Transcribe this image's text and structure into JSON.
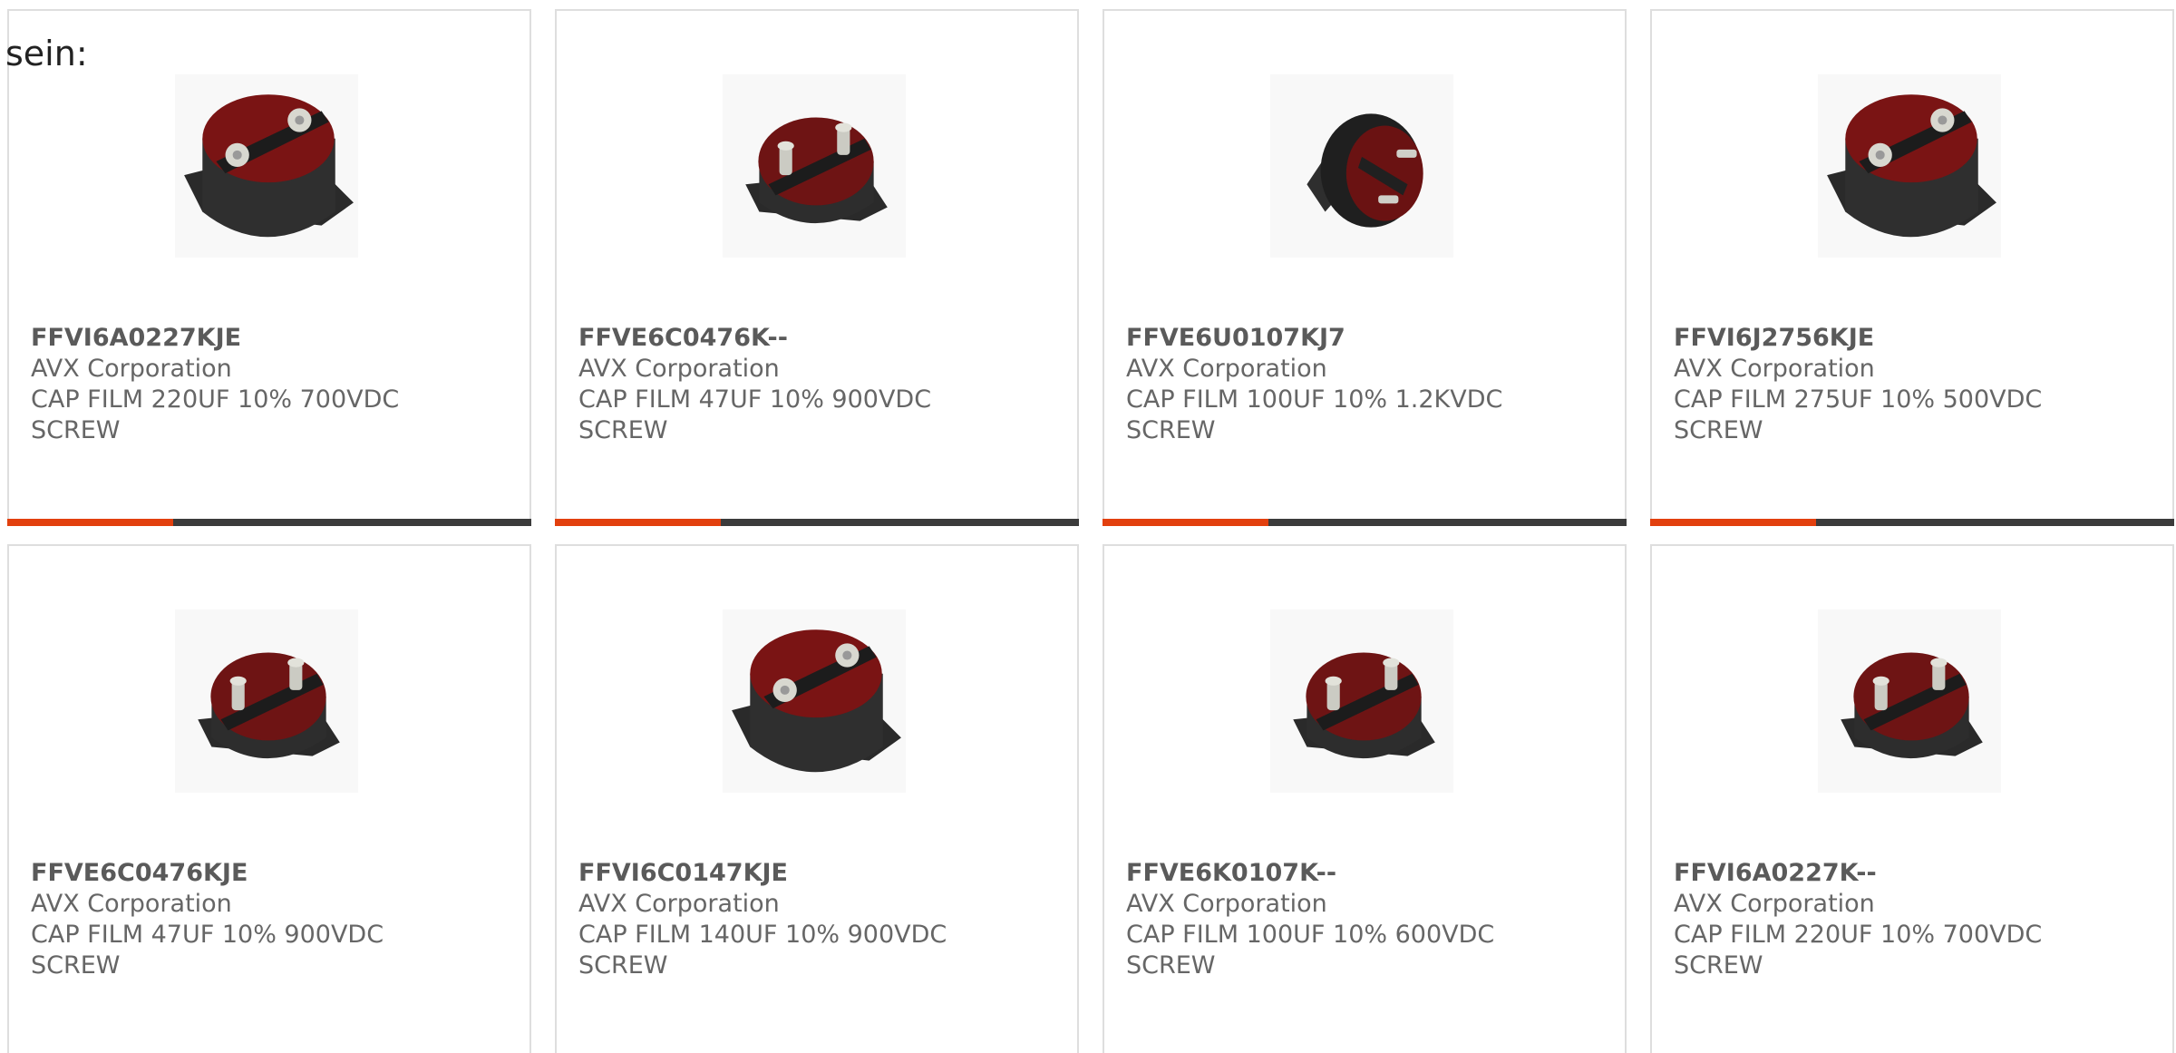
{
  "intro_text": "sein:",
  "colors": {
    "accent": "#e2400e",
    "bar": "#3b3b3b",
    "text": "#666666",
    "border": "#dedede"
  },
  "products": [
    {
      "part_number": "FFVI6A0227KJE",
      "manufacturer": "AVX Corporation",
      "description": "CAP FILM 220UF 10% 700VDC",
      "mount": "SCREW",
      "image": "capacitor-large-top-icon"
    },
    {
      "part_number": "FFVE6C0476K--",
      "manufacturer": "AVX Corporation",
      "description": "CAP FILM 47UF 10% 900VDC",
      "mount": "SCREW",
      "image": "capacitor-small-icon"
    },
    {
      "part_number": "FFVE6U0107KJ7",
      "manufacturer": "AVX Corporation",
      "description": "CAP FILM 100UF 10% 1.2KVDC",
      "mount": "SCREW",
      "image": "capacitor-side-icon"
    },
    {
      "part_number": "FFVI6J2756KJE",
      "manufacturer": "AVX Corporation",
      "description": "CAP FILM 275UF 10% 500VDC",
      "mount": "SCREW",
      "image": "capacitor-large-top-icon"
    },
    {
      "part_number": "FFVE6C0476KJE",
      "manufacturer": "AVX Corporation",
      "description": "CAP FILM 47UF 10% 900VDC",
      "mount": "SCREW",
      "image": "capacitor-small-icon"
    },
    {
      "part_number": "FFVI6C0147KJE",
      "manufacturer": "AVX Corporation",
      "description": "CAP FILM 140UF 10% 900VDC",
      "mount": "SCREW",
      "image": "capacitor-large-top-icon"
    },
    {
      "part_number": "FFVE6K0107K--",
      "manufacturer": "AVX Corporation",
      "description": "CAP FILM 100UF 10% 600VDC",
      "mount": "SCREW",
      "image": "capacitor-small-icon"
    },
    {
      "part_number": "FFVI6A0227K--",
      "manufacturer": "AVX Corporation",
      "description": "CAP FILM 220UF 10% 700VDC",
      "mount": "SCREW",
      "image": "capacitor-small-icon"
    }
  ]
}
